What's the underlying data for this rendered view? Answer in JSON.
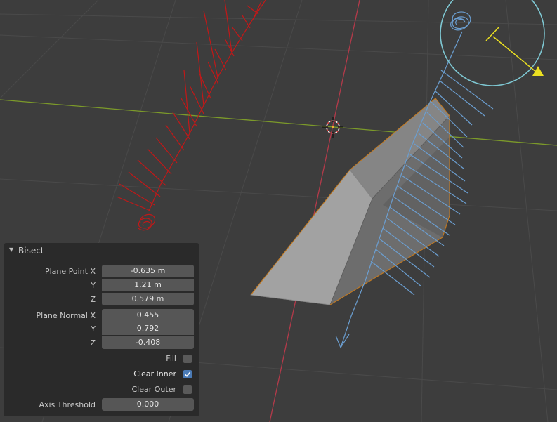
{
  "colors": {
    "background": "#3d3d3d",
    "x_axis": "#b43a4a",
    "y_axis": "#7c9a2a",
    "panel_bg": "#2a2a2a",
    "field_bg": "#565656",
    "checkbox_on": "#4b7bb6",
    "red_annotation": "#c21818",
    "blue_annotation": "#6b9ed0",
    "light_gizmo": "#ebe021",
    "light_circle": "#7ec7d2"
  },
  "panel": {
    "title": "Bisect",
    "plane_point": {
      "label": "Plane Point X",
      "y_label": "Y",
      "z_label": "Z",
      "x": "-0.635 m",
      "y": "1.21 m",
      "z": "0.579 m"
    },
    "plane_normal": {
      "label": "Plane Normal X",
      "y_label": "Y",
      "z_label": "Z",
      "x": "0.455",
      "y": "0.792",
      "z": "-0.408"
    },
    "fill": {
      "label": "Fill",
      "checked": false
    },
    "clear_inner": {
      "label": "Clear Inner",
      "checked": true
    },
    "clear_outer": {
      "label": "Clear Outer",
      "checked": false
    },
    "axis_threshold": {
      "label": "Axis Threshold",
      "value": "0.000"
    }
  }
}
